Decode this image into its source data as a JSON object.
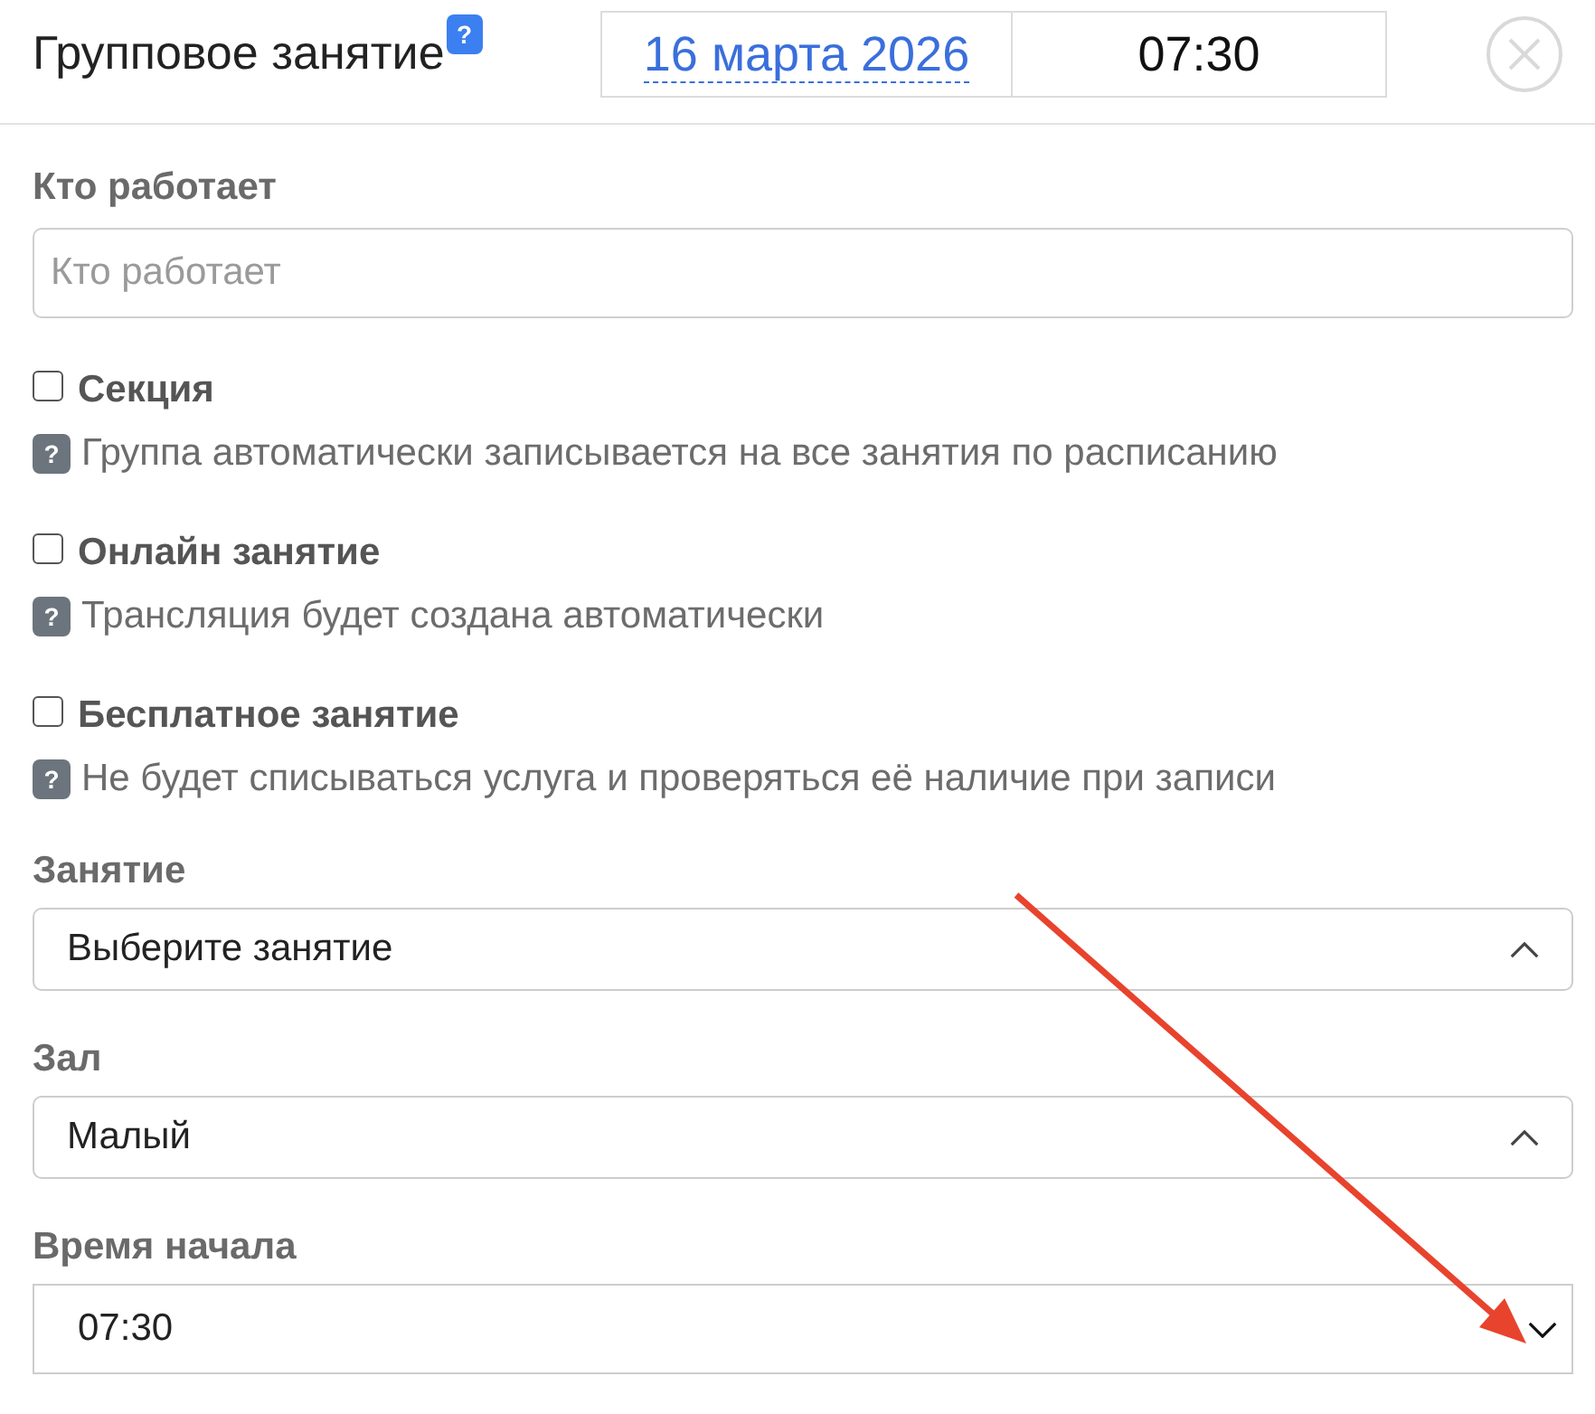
{
  "header": {
    "title": "Групповое занятие",
    "help_badge": "?",
    "date": "16 марта 2026",
    "time": "07:30"
  },
  "worker_field": {
    "label": "Кто работает",
    "placeholder": "Кто работает"
  },
  "options": [
    {
      "label": "Секция",
      "checked": false,
      "hint_badge": "?",
      "hint": "Группа автоматически записывается на все занятия по расписанию"
    },
    {
      "label": "Онлайн занятие",
      "checked": false,
      "hint_badge": "?",
      "hint": "Трансляция будет создана автоматически"
    },
    {
      "label": "Бесплатное занятие",
      "checked": false,
      "hint_badge": "?",
      "hint": "Не будет списываться услуга и проверяться её наличие при записи"
    }
  ],
  "selects": [
    {
      "label": "Занятие",
      "value": "Выберите занятие",
      "kind": "multiselect",
      "expanded": true,
      "annotated": false
    },
    {
      "label": "Зал",
      "value": "Малый",
      "kind": "multiselect",
      "expanded": true,
      "annotated": false
    },
    {
      "label": "Время начала",
      "value": "07:30",
      "kind": "native",
      "expanded": false,
      "annotated": true
    }
  ]
}
